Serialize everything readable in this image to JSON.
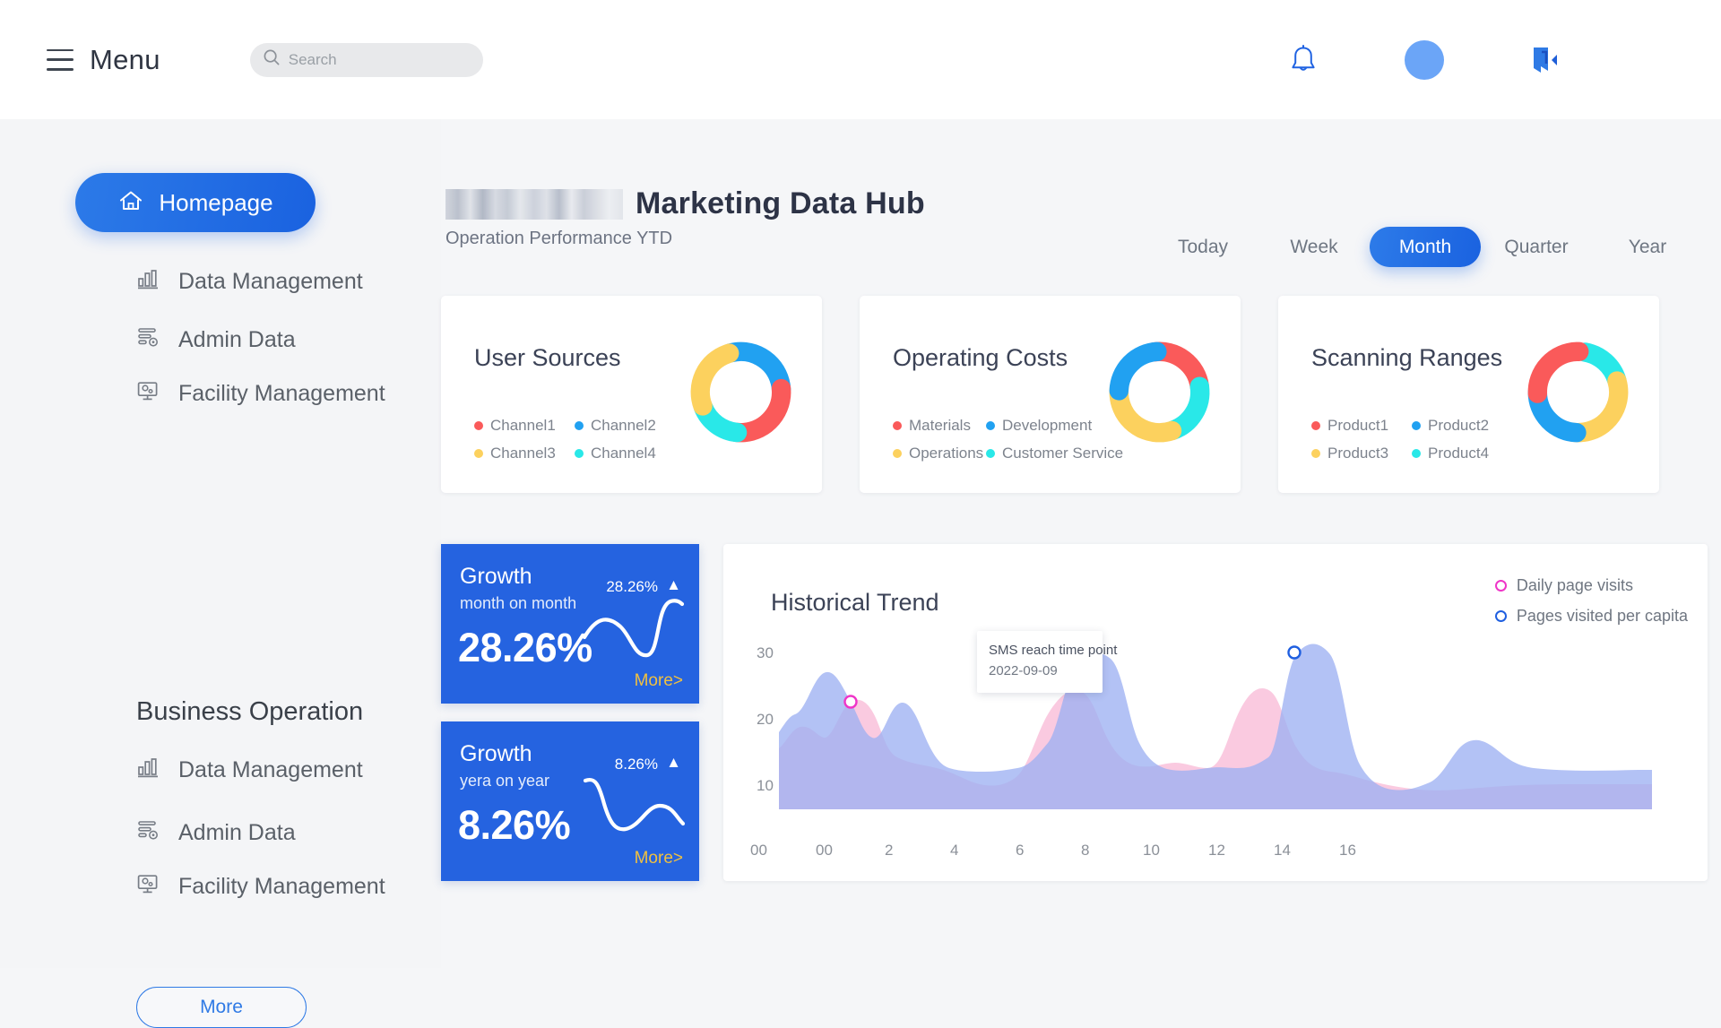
{
  "topbar": {
    "menu_label": "Menu",
    "search": {
      "value": "",
      "placeholder": "Search"
    },
    "icons": {
      "bell": "bell-icon",
      "avatar": "avatar",
      "logout": "logout-icon"
    }
  },
  "sidebar": {
    "home": {
      "label": "Homepage",
      "icon": "home-icon",
      "active": true
    },
    "primary_items": [
      {
        "label": "Data Management",
        "icon": "bar-chart-icon"
      },
      {
        "label": "Admin Data",
        "icon": "admin-settings-icon"
      },
      {
        "label": "Facility Management",
        "icon": "monitor-settings-icon"
      }
    ],
    "section_title": "Business Operation",
    "secondary_items": [
      {
        "label": "Data Management",
        "icon": "bar-chart-icon"
      },
      {
        "label": "Admin Data",
        "icon": "admin-settings-icon"
      },
      {
        "label": "Facility Management",
        "icon": "monitor-settings-icon"
      }
    ],
    "more_button": "More"
  },
  "header": {
    "logo": "blurred-logo",
    "title": "Marketing Data Hub",
    "subtitle": "Operation Performance YTD",
    "range_tabs": [
      {
        "label": "Today",
        "active": false
      },
      {
        "label": "Week",
        "active": false
      },
      {
        "label": "Month",
        "active": true
      },
      {
        "label": "Quarter",
        "active": false
      },
      {
        "label": "Year",
        "active": false
      }
    ]
  },
  "colors": {
    "red": "#fa5a5a",
    "blue": "#21a1f1",
    "yellow": "#fcd15e",
    "cyan": "#29e8e8",
    "accent": "#2563e0",
    "gold": "#f0c040",
    "pink_series": "#f9bcd8",
    "blue_series": "#9db1f2",
    "legend_pink": "#ef35c8",
    "legend_blue": "#1f5fe0"
  },
  "chart_data": [
    {
      "type": "pie",
      "title": "User Sources",
      "categories": [
        "Channel1",
        "Channel2",
        "Channel3",
        "Channel4"
      ],
      "values": [
        27,
        27,
        27,
        19
      ],
      "colors": [
        "#fa5a5a",
        "#21a1f1",
        "#fcd15e",
        "#29e8e8"
      ],
      "legend_position": "left",
      "donut": true
    },
    {
      "type": "pie",
      "title": "Operating Costs",
      "categories": [
        "Materials",
        "Development",
        "Operations",
        "Customer Service"
      ],
      "values": [
        25,
        22,
        31,
        22
      ],
      "colors": [
        "#fa5a5a",
        "#21a1f1",
        "#fcd15e",
        "#29e8e8"
      ],
      "legend_position": "left",
      "donut": true
    },
    {
      "type": "pie",
      "title": "Scanning Ranges",
      "categories": [
        "Product1",
        "Product2",
        "Product3",
        "Product4"
      ],
      "values": [
        25,
        25,
        31,
        19
      ],
      "colors": [
        "#fa5a5a",
        "#21a1f1",
        "#fcd15e",
        "#29e8e8"
      ],
      "legend_position": "left",
      "donut": true
    },
    {
      "type": "area",
      "title": "Historical Trend",
      "xlabel": "",
      "ylabel": "",
      "x_ticks": [
        "00",
        "00",
        "2",
        "4",
        "6",
        "8",
        "10",
        "12",
        "14",
        "16"
      ],
      "y_ticks": [
        10,
        20,
        30
      ],
      "ylim": [
        0,
        33
      ],
      "grid": false,
      "legend_position": "top-right",
      "series": [
        {
          "name": "Daily page visits",
          "color": "#f9bcd8",
          "marker_color": "#ef35c8",
          "values": [
            9,
            12,
            14,
            21,
            13,
            11,
            9,
            8,
            11,
            18,
            25,
            22,
            14,
            10,
            13,
            24,
            21,
            12,
            9,
            8,
            7,
            8,
            9
          ]
        },
        {
          "name": "Pages visited per capita",
          "color": "#9db1f2",
          "marker_color": "#1f5fe0",
          "values": [
            12,
            15,
            21,
            17,
            12,
            17,
            13,
            10,
            10,
            13,
            20,
            26,
            22,
            13,
            12,
            16,
            27,
            23,
            13,
            9,
            11,
            16,
            15
          ]
        }
      ],
      "annotation": {
        "line1": "SMS reach time point",
        "line2": "2022-09-09"
      },
      "markers": [
        {
          "series": "Daily page visits",
          "x": 3,
          "y": 21
        },
        {
          "series": "Pages visited per capita",
          "x": 11,
          "y": 26
        }
      ]
    }
  ],
  "growth_cards": [
    {
      "title": "Growth",
      "subtitle": "month on month",
      "delta": "28.26%",
      "arrow": "▲",
      "value": "28.26%",
      "more": "More>"
    },
    {
      "title": "Growth",
      "subtitle": "yera on year",
      "delta": "8.26%",
      "arrow": "▲",
      "value": "8.26%",
      "more": "More>"
    }
  ]
}
